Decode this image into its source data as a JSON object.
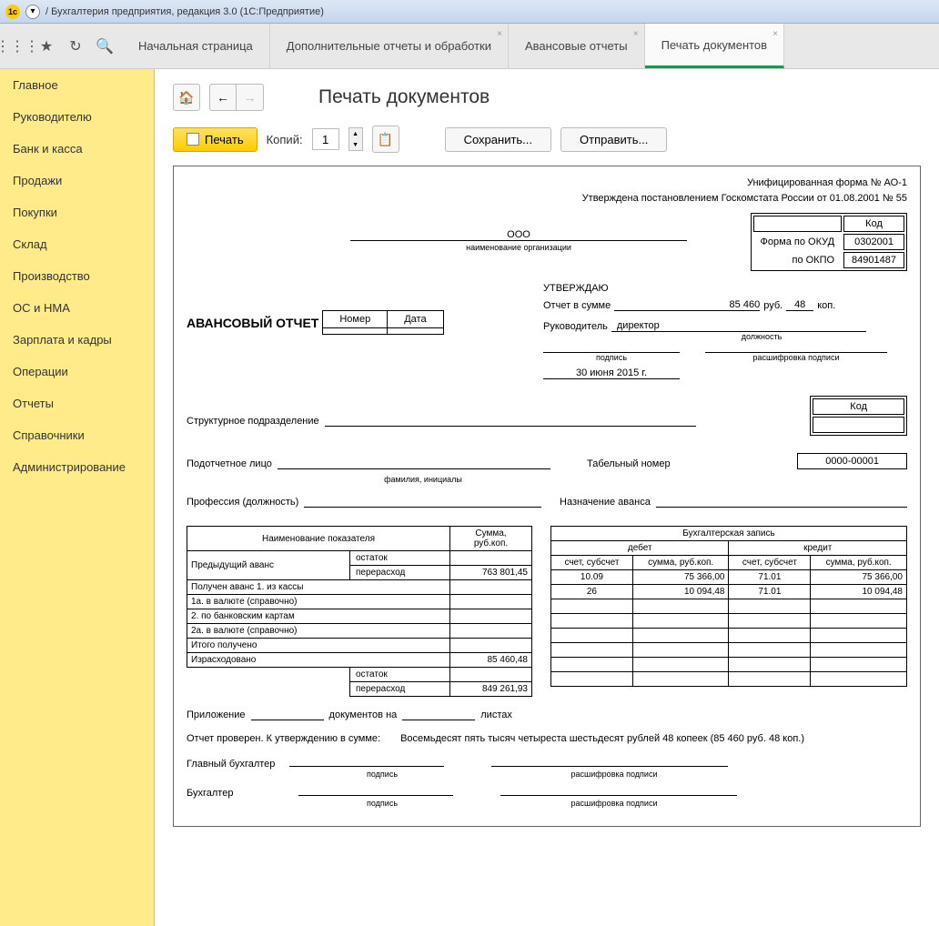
{
  "titlebar": {
    "app_title": "/ Бухгалтерия предприятия, редакция 3.0  (1С:Предприятие)"
  },
  "tabs": {
    "start": "Начальная страница",
    "addons": "Дополнительные отчеты и обработки",
    "advance": "Авансовые отчеты",
    "print": "Печать документов"
  },
  "sidebar": {
    "items": [
      "Главное",
      "Руководителю",
      "Банк и касса",
      "Продажи",
      "Покупки",
      "Склад",
      "Производство",
      "ОС и НМА",
      "Зарплата и кадры",
      "Операции",
      "Отчеты",
      "Справочники",
      "Администрирование"
    ]
  },
  "page": {
    "title": "Печать документов",
    "print_btn": "Печать",
    "copies_label": "Копий:",
    "copies_value": "1",
    "save_btn": "Сохранить...",
    "send_btn": "Отправить..."
  },
  "doc": {
    "form_line1": "Унифицированная форма № АО-1",
    "form_line2": "Утверждена постановлением Госкомстата России от  01.08.2001 № 55",
    "code_hdr": "Код",
    "okud_lbl": "Форма по ОКУД",
    "okud_val": "0302001",
    "okpo_lbl": "по ОКПО",
    "okpo_val": "84901487",
    "org_name": "ООО",
    "org_sublabel": "наименование организации",
    "approve": "УТВЕРЖДАЮ",
    "report_sum_lbl": "Отчет в сумме",
    "sum_rub": "85 460",
    "rub": "руб.",
    "sum_kop": "48",
    "kop": "коп.",
    "manager_lbl": "Руководитель",
    "manager_pos": "директор",
    "position_sub": "должность",
    "sign_sub": "подпись",
    "decode_sub": "расшифровка подписи",
    "date_val": "30 июня 2015 г.",
    "report_title": "АВАНСОВЫЙ ОТЧЕТ",
    "number_hdr": "Номер",
    "date_hdr": "Дата",
    "number_val": "",
    "date_cell_val": "",
    "struct_unit_lbl": "Структурное подразделение",
    "code_hdr2": "Код",
    "account_person_lbl": "Подотчетное лицо",
    "fio_sub": "фамилия, инициалы",
    "tab_num_lbl": "Табельный номер",
    "tab_num_val": "0000-00001",
    "profession_lbl": "Профессия (должность)",
    "purpose_lbl": "Назначение аванса",
    "indicator_hdr": "Наименование показателя",
    "sum_hdr": "Сумма,\nруб.коп.",
    "prev_advance": "Предыдущий аванс",
    "balance": "остаток",
    "overdraft": "перерасход",
    "row1": "Получен аванс 1. из кассы",
    "row2": "1а. в валюте (справочно)",
    "row3": "2. по банковским картам",
    "row4": "2а. в валюте (справочно)",
    "row5": "Итого получено",
    "row6": "Израсходовано",
    "sum1": "763 801,45",
    "sum2": "85 460,48",
    "sum3": "849 261,93",
    "acct_entry_hdr": "Бухгалтерская запись",
    "debit_hdr": "дебет",
    "credit_hdr": "кредит",
    "acct_sub_hdr": "счет, субсчет",
    "amt_sub_hdr": "сумма, руб.коп.",
    "d1_acct": "10.09",
    "d1_amt": "75 366,00",
    "c1_acct": "71.01",
    "c1_amt": "75 366,00",
    "d2_acct": "26",
    "d2_amt": "10 094,48",
    "c2_acct": "71.01",
    "c2_amt": "10 094,48",
    "attachment_lbl": "Приложение",
    "docs_on_lbl": "документов на",
    "sheets_lbl": "листах",
    "checked_lbl": "Отчет проверен. К утверждению в сумме:",
    "checked_val": "Восемьдесят пять тысяч четыреста шестьдесят рублей 48 копеек (85 460 руб. 48 коп.)",
    "chief_acct_lbl": "Главный бухгалтер",
    "acct_lbl": "Бухгалтер"
  }
}
